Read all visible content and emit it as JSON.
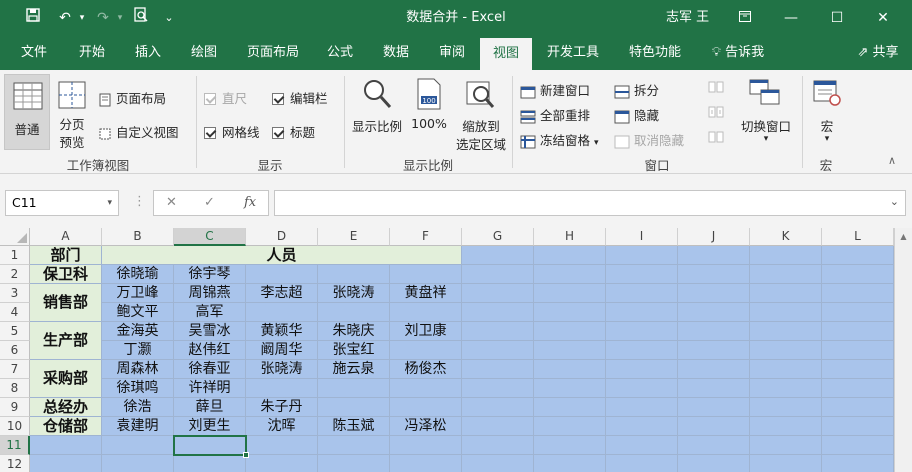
{
  "window": {
    "title": "数据合并  -  Excel",
    "user": "志军 王"
  },
  "tabs": [
    "文件",
    "开始",
    "插入",
    "绘图",
    "页面布局",
    "公式",
    "数据",
    "审阅",
    "视图",
    "开发工具",
    "特色功能",
    "告诉我"
  ],
  "share_label": "共享",
  "ribbon": {
    "workbook_views": {
      "normal": "普通",
      "page_break_1": "分页",
      "page_break_2": "预览",
      "page_layout": "页面布局",
      "custom_views": "自定义视图",
      "label": "工作簿视图"
    },
    "show": {
      "ruler": "直尺",
      "formula_bar": "编辑栏",
      "gridlines": "网格线",
      "headings": "标题",
      "label": "显示"
    },
    "zoom": {
      "zoom": "显示比例",
      "hundred": "100%",
      "zoom_sel_1": "缩放到",
      "zoom_sel_2": "选定区域",
      "label": "显示比例"
    },
    "window": {
      "new_window": "新建窗口",
      "arrange_all": "全部重排",
      "freeze": "冻结窗格",
      "split": "拆分",
      "hide": "隐藏",
      "unhide": "取消隐藏",
      "switch": "切换窗口",
      "label": "窗口"
    },
    "macros": {
      "macro": "宏",
      "label": "宏"
    }
  },
  "formula_bar": {
    "name_box": "C11",
    "formula": ""
  },
  "sheet": {
    "columns": [
      "A",
      "B",
      "C",
      "D",
      "E",
      "F",
      "G",
      "H",
      "I",
      "J",
      "K",
      "L"
    ],
    "rows": [
      "1",
      "2",
      "3",
      "4",
      "5",
      "6",
      "7",
      "8",
      "9",
      "10",
      "11",
      "12"
    ],
    "header_dept": "部门",
    "header_staff": "人员",
    "depts": [
      "保卫科",
      "销售部",
      "生产部",
      "采购部",
      "总经办",
      "仓储部"
    ],
    "names": {
      "r2": [
        "徐晓瑜",
        "徐宇琴",
        "",
        "",
        ""
      ],
      "r3": [
        "万卫峰",
        "周锦燕",
        "李志超",
        "张晓涛",
        "黄盘祥"
      ],
      "r4": [
        "鲍文平",
        "高军",
        "",
        "",
        ""
      ],
      "r5": [
        "金海英",
        "吴雪冰",
        "黄颖华",
        "朱晓庆",
        "刘卫康"
      ],
      "r6": [
        "丁灏",
        "赵伟红",
        "阚周华",
        "张宝红",
        ""
      ],
      "r7": [
        "周森林",
        "徐春亚",
        "张晓涛",
        "施云泉",
        "杨俊杰"
      ],
      "r8": [
        "徐琪鸣",
        "许祥明",
        "",
        "",
        ""
      ],
      "r9": [
        "徐浩",
        "薛旦",
        "朱子丹",
        "",
        ""
      ],
      "r10": [
        "袁建明",
        "刘更生",
        "沈晖",
        "陈玉斌",
        "冯泽松"
      ]
    }
  }
}
